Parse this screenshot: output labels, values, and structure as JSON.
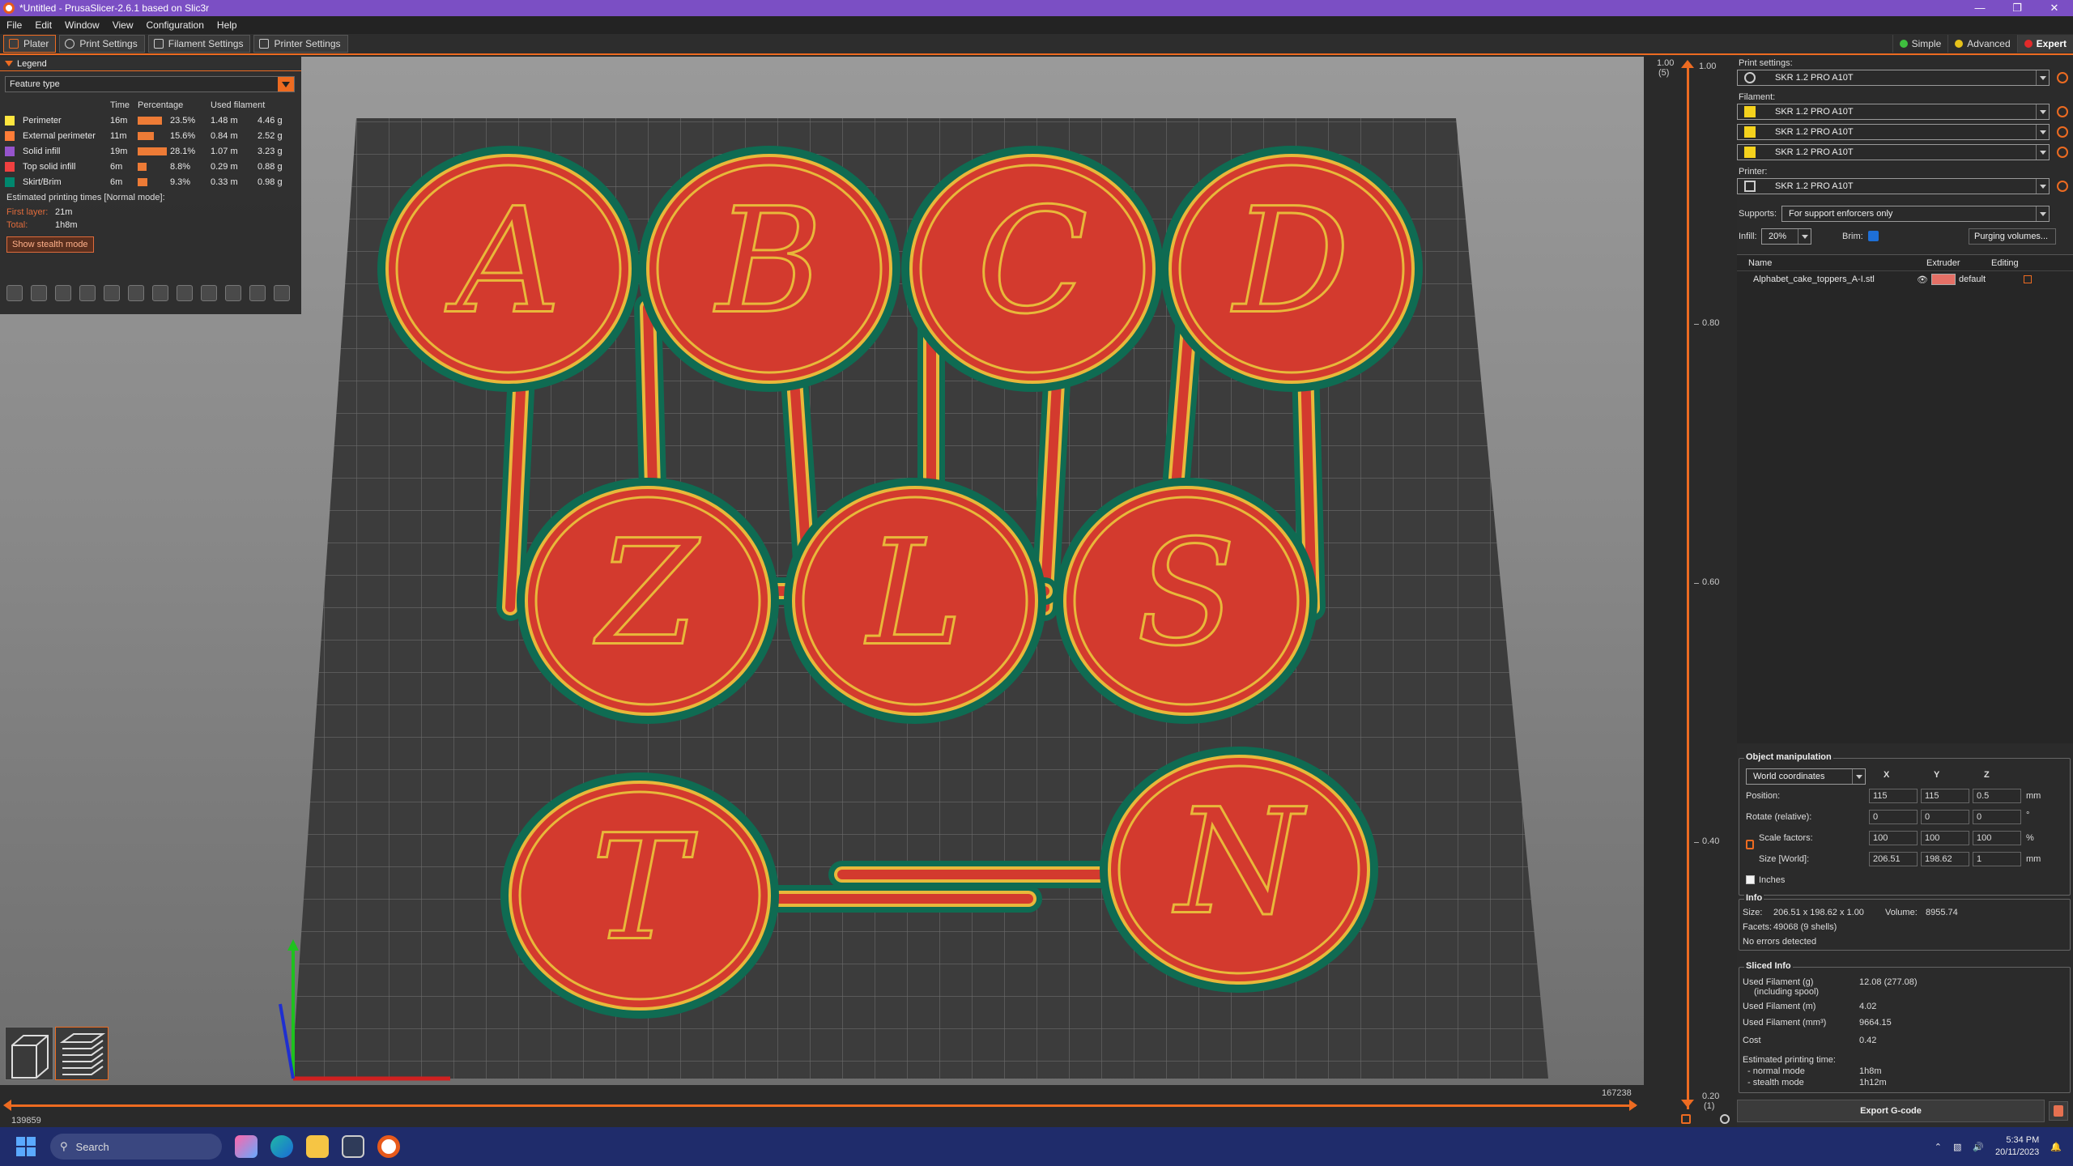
{
  "window": {
    "title": "*Untitled - PrusaSlicer-2.6.1 based on Slic3r"
  },
  "menu": [
    "File",
    "Edit",
    "Window",
    "View",
    "Configuration",
    "Help"
  ],
  "tabs": [
    "Plater",
    "Print Settings",
    "Filament Settings",
    "Printer Settings"
  ],
  "modes": [
    {
      "label": "Simple",
      "color": "#3fbf3f"
    },
    {
      "label": "Advanced",
      "color": "#e6c21a"
    },
    {
      "label": "Expert",
      "color": "#e22a2a"
    }
  ],
  "legend": {
    "title": "Legend",
    "view_type": "Feature type",
    "headers": {
      "time": "Time",
      "percentage": "Percentage",
      "used": "Used filament"
    },
    "rows": [
      {
        "name": "Perimeter",
        "time": "16m",
        "pct": "23.5%",
        "pct_value": 23.5,
        "len": "1.48 m",
        "weight": "4.46 g",
        "color": "#ffe63f"
      },
      {
        "name": "External perimeter",
        "time": "11m",
        "pct": "15.6%",
        "pct_value": 15.6,
        "len": "0.84 m",
        "weight": "2.52 g",
        "color": "#ff7d38"
      },
      {
        "name": "Solid infill",
        "time": "19m",
        "pct": "28.1%",
        "pct_value": 28.1,
        "len": "1.07 m",
        "weight": "3.23 g",
        "color": "#9654cc"
      },
      {
        "name": "Top solid infill",
        "time": "6m",
        "pct": "8.8%",
        "pct_value": 8.8,
        "len": "0.29 m",
        "weight": "0.88 g",
        "color": "#f04040"
      },
      {
        "name": "Skirt/Brim",
        "time": "6m",
        "pct": "9.3%",
        "pct_value": 9.3,
        "len": "0.33 m",
        "weight": "0.98 g",
        "color": "#00876e"
      }
    ],
    "estimated_title": "Estimated printing times [Normal mode]:",
    "first_layer_label": "First layer:",
    "first_layer": "21m",
    "total_label": "Total:",
    "total": "1h8m",
    "stealth_button": "Show stealth mode"
  },
  "viewport": {
    "letters_top": [
      "A",
      "B",
      "C",
      "D"
    ],
    "letters_mid": [
      "Z",
      "L",
      "S"
    ],
    "letters_bottom": [
      "T",
      "N"
    ]
  },
  "vslider": {
    "top": "1.00",
    "top_sub": "(5)",
    "top_right": "1.00",
    "ticks": [
      "0.80",
      "0.60",
      "0.40"
    ],
    "bottom": "0.20",
    "bottom_sub": "(1)"
  },
  "hslider": {
    "left": "139859",
    "right": "167238"
  },
  "right": {
    "print_settings_label": "Print settings:",
    "print_profile": "SKR 1.2 PRO A10T",
    "filament_label": "Filament:",
    "filaments": [
      "SKR 1.2 PRO A10T",
      "SKR 1.2 PRO A10T",
      "SKR 1.2 PRO A10T"
    ],
    "printer_label": "Printer:",
    "printer_profile": "SKR 1.2 PRO A10T",
    "supports_label": "Supports:",
    "supports": "For support enforcers only",
    "infill_label": "Infill:",
    "infill": "20%",
    "brim_label": "Brim:",
    "purging_button": "Purging volumes...",
    "table_headers": {
      "name": "Name",
      "extruder": "Extruder",
      "editing": "Editing"
    },
    "object_name": "Alphabet_cake_toppers_A-I.stl",
    "object_extruder": "default",
    "manipulation": {
      "title": "Object manipulation",
      "coords": "World coordinates",
      "axes": [
        "X",
        "Y",
        "Z"
      ],
      "position_label": "Position:",
      "position": [
        "115",
        "115",
        "0.5"
      ],
      "position_unit": "mm",
      "rotate_label": "Rotate (relative):",
      "rotate": [
        "0",
        "0",
        "0"
      ],
      "rotate_unit": "°",
      "scale_label": "Scale factors:",
      "scale": [
        "100",
        "100",
        "100"
      ],
      "scale_unit": "%",
      "size_label": "Size [World]:",
      "size": [
        "206.51",
        "198.62",
        "1"
      ],
      "size_unit": "mm",
      "inches_label": "Inches"
    },
    "info": {
      "title": "Info",
      "size_label": "Size:",
      "size": "206.51 x 198.62 x 1.00",
      "volume_label": "Volume:",
      "volume": "8955.74",
      "facets_label": "Facets:",
      "facets": "49068 (9 shells)",
      "errors": "No errors detected"
    },
    "sliced": {
      "title": "Sliced Info",
      "rows": [
        {
          "k": "Used Filament (g)",
          "k2": "(including spool)",
          "v": "12.08 (277.08)"
        },
        {
          "k": "Used Filament (m)",
          "v": "4.02"
        },
        {
          "k": "Used Filament (mm³)",
          "v": "9664.15"
        },
        {
          "k": "Cost",
          "v": "0.42"
        }
      ],
      "est_label": "Estimated printing time:",
      "normal_label": "- normal mode",
      "normal": "1h8m",
      "stealth_label": "- stealth mode",
      "stealth": "1h12m"
    },
    "export_button": "Export G-code"
  },
  "taskbar": {
    "search": "Search",
    "time": "5:34 PM",
    "date": "20/11/2023"
  }
}
